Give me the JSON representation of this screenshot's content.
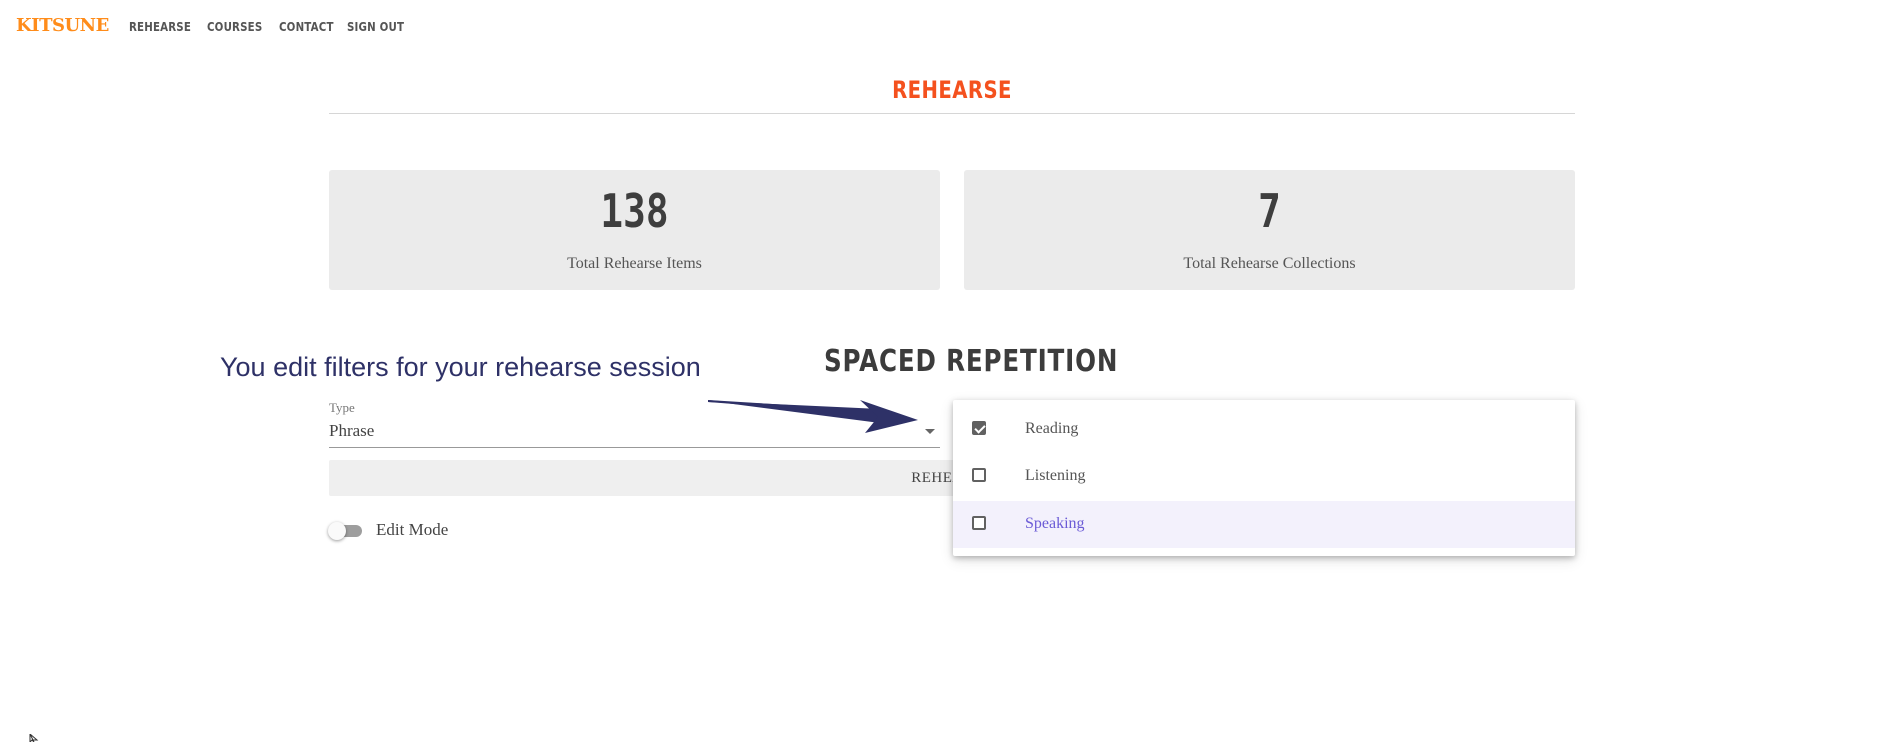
{
  "nav": {
    "logo": "KITSUNE",
    "links": [
      "REHEARSE",
      "COURSES",
      "CONTACT",
      "SIGN OUT"
    ]
  },
  "page": {
    "title": "REHEARSE"
  },
  "stats": [
    {
      "value": "138",
      "label": "Total Rehearse Items"
    },
    {
      "value": "7",
      "label": "Total Rehearse Collections"
    }
  ],
  "annotation": {
    "text": "You edit filters for your rehearse session"
  },
  "section": {
    "title": "SPACED REPETITION"
  },
  "type_select": {
    "label": "Type",
    "value": "Phrase"
  },
  "rehearse_button": {
    "label": "REHEARSE"
  },
  "edit_mode": {
    "label": "Edit Mode",
    "enabled": false
  },
  "skill_menu": {
    "options": [
      {
        "label": "Reading",
        "checked": true
      },
      {
        "label": "Listening",
        "checked": false
      },
      {
        "label": "Speaking",
        "checked": false,
        "highlighted": true
      }
    ]
  },
  "colors": {
    "brand": "#ff8c1a",
    "accent": "#f4511e",
    "annotation": "#2e3167",
    "highlight_text": "#6b5bd6"
  }
}
